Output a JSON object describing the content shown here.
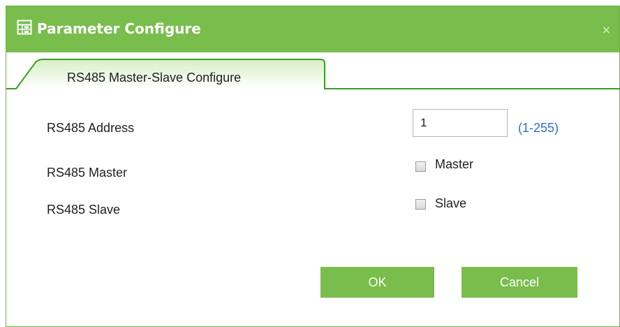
{
  "dialog": {
    "title": "Parameter Configure",
    "close_glyph": "×"
  },
  "tabs": [
    {
      "label": "RS485 Master-Slave Configure",
      "active": true
    }
  ],
  "form": {
    "address_label": "RS485 Address",
    "address_value": "1",
    "address_range": "(1-255)",
    "master_label": "RS485 Master",
    "master_option": "Master",
    "master_checked": false,
    "slave_label": "RS485 Slave",
    "slave_option": "Slave",
    "slave_checked": false
  },
  "buttons": {
    "ok": "OK",
    "cancel": "Cancel"
  },
  "icons": {
    "title": "settings-grid-icon",
    "close": "close-icon"
  },
  "colors": {
    "accent": "#79bd4c",
    "link": "#2f6fc7"
  }
}
